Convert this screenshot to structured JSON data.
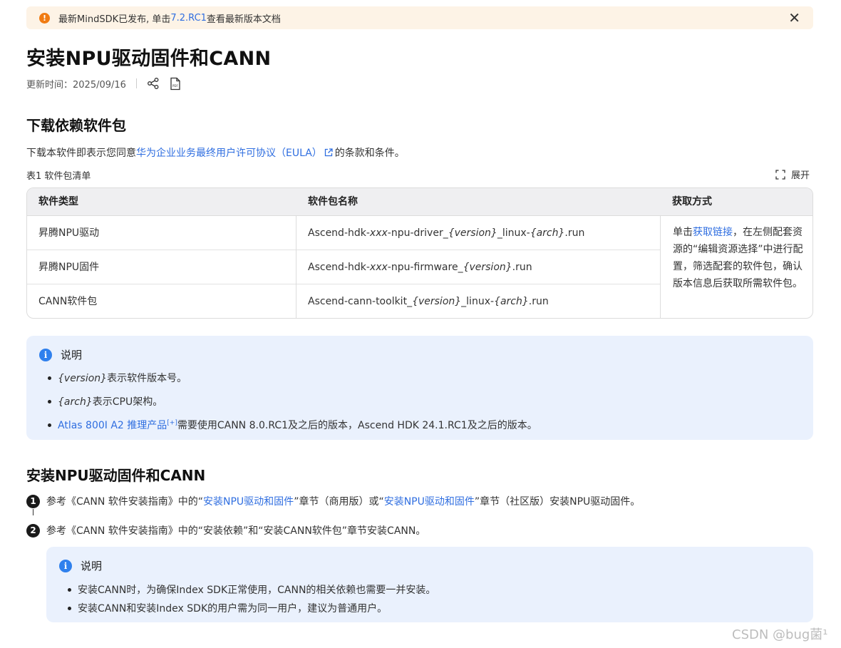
{
  "banner": {
    "text_before": "最新MindSDK已发布, 单击 ",
    "link": "7.2.RC1",
    "text_after": " 查看最新版本文档",
    "icon": "warning-icon",
    "close": "✕"
  },
  "page": {
    "title": "安装NPU驱动固件和CANN",
    "updated": "更新时间：2025/09/16"
  },
  "download": {
    "heading": "下载依赖软件包",
    "agree_before": "下载本软件即表示您同意",
    "agree_link": "华为企业业务最终用户许可协议（EULA）",
    "agree_after": "的条款和条件。",
    "table_caption": "表1 软件包清单",
    "expand_label": "展开"
  },
  "table": {
    "headers": [
      "软件类型",
      "软件包名称",
      "获取方式"
    ],
    "rows": [
      {
        "type": "昇腾NPU驱动",
        "p1": "Ascend-hdk-",
        "v1": "xxx",
        "p2": "-npu-driver_",
        "v2": "{version}",
        "p3": "_linux-",
        "v3": "{arch}",
        "p4": ".run"
      },
      {
        "type": "昇腾NPU固件",
        "p1": "Ascend-hdk-",
        "v1": "xxx",
        "p2": "-npu-firmware_",
        "v2": "{version}",
        "p3": ".run"
      },
      {
        "type": "CANN软件包",
        "p1": "Ascend-cann-toolkit_",
        "v1": "{version}",
        "p2": "_linux-",
        "v2": "{arch}",
        "p3": ".run"
      }
    ],
    "get": {
      "before": "单击",
      "link": "获取链接",
      "after": "，在左侧配套资源的“编辑资源选择”中进行配置，筛选配套的软件包，确认版本信息后获取所需软件包。"
    }
  },
  "note1": {
    "title": "说明",
    "items": [
      {
        "var": "{version}",
        "text": "表示软件版本号。"
      },
      {
        "var": "{arch}",
        "text": "表示CPU架构。"
      },
      {
        "link": "Atlas 800I A2 推理产品",
        "sup": "[+]",
        "text": "需要使用CANN 8.0.RC1及之后的版本，Ascend HDK 24.1.RC1及之后的版本。"
      }
    ]
  },
  "install": {
    "heading": "安装NPU驱动固件和CANN",
    "steps": [
      {
        "num": "1",
        "a": "参考《CANN 软件安装指南》中的“",
        "link1": "安装NPU驱动和固件",
        "b": "”章节（商用版）或“",
        "link2": "安装NPU驱动和固件",
        "c": "”章节（社区版）安装NPU驱动固件。"
      },
      {
        "num": "2",
        "text": "参考《CANN 软件安装指南》中的“安装依赖”和“安装CANN软件包”章节安装CANN。"
      }
    ]
  },
  "note2": {
    "title": "说明",
    "items": [
      "安装CANN时，为确保Index SDK正常使用，CANN的相关依赖也需要一并安装。",
      "安装CANN和安装Index SDK的用户需为同一用户，建议为普通用户。"
    ]
  },
  "watermark": "CSDN @bug菌¹",
  "colors": {
    "link": "#2f6ee0",
    "banner_bg": "#fdf3e6",
    "note_bg": "#eaf1fd",
    "warn": "#f07b12",
    "info": "#2f80ed"
  }
}
